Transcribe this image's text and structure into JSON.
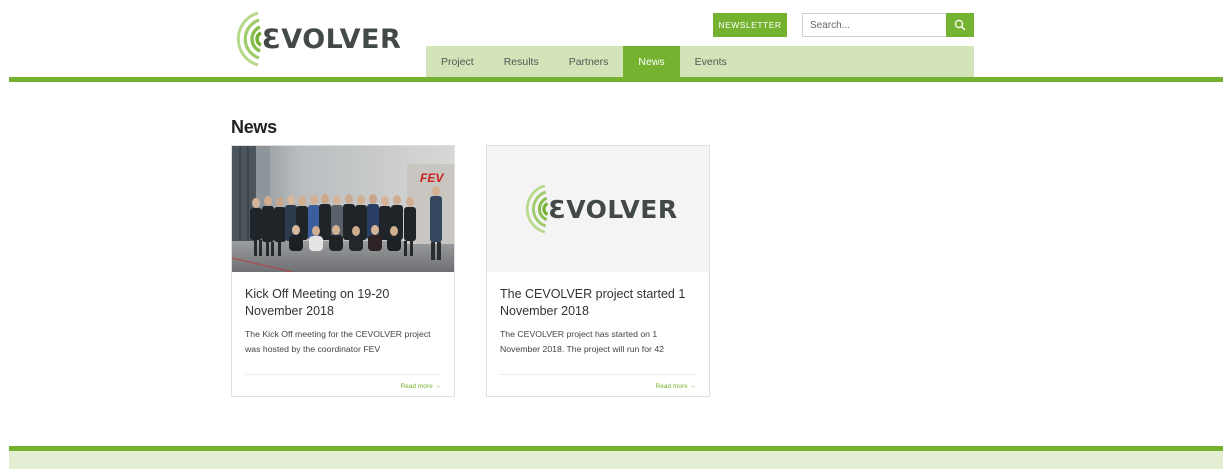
{
  "brand": {
    "logo_text": "CEVOLVER",
    "logo_label": "ƐVOLVER",
    "accent": "#74b230",
    "nav_bg": "#d4e4b9",
    "footer_bg": "#e3eed3",
    "logo_text_color": "#434a45"
  },
  "header": {
    "newsletter_label": "NEWSLETTER",
    "search": {
      "placeholder": "Search...",
      "icon": "search-icon"
    }
  },
  "nav": {
    "items": [
      {
        "label": "Project",
        "active": false
      },
      {
        "label": "Results",
        "active": false
      },
      {
        "label": "Partners",
        "active": false
      },
      {
        "label": "News",
        "active": true
      },
      {
        "label": "Events",
        "active": false
      }
    ]
  },
  "main": {
    "title": "News",
    "cards": [
      {
        "title": "Kick Off Meeting on 19-20 November 2018",
        "excerpt": "The Kick Off meeting for the CEVOLVER project was hosted by the coordinator FEV",
        "read_more": "Read more",
        "read_more_icon": "arrow-right-icon",
        "image": "group-photo",
        "sign_text": "FEV"
      },
      {
        "title": "The CEVOLVER project started 1 November 2018",
        "excerpt": "The CEVOLVER project has started on 1 November 2018. The project will run for 42",
        "read_more": "Read more",
        "read_more_icon": "arrow-right-icon",
        "image": "cevolver-logo",
        "logo_label": "ƐVOLVER"
      }
    ]
  }
}
